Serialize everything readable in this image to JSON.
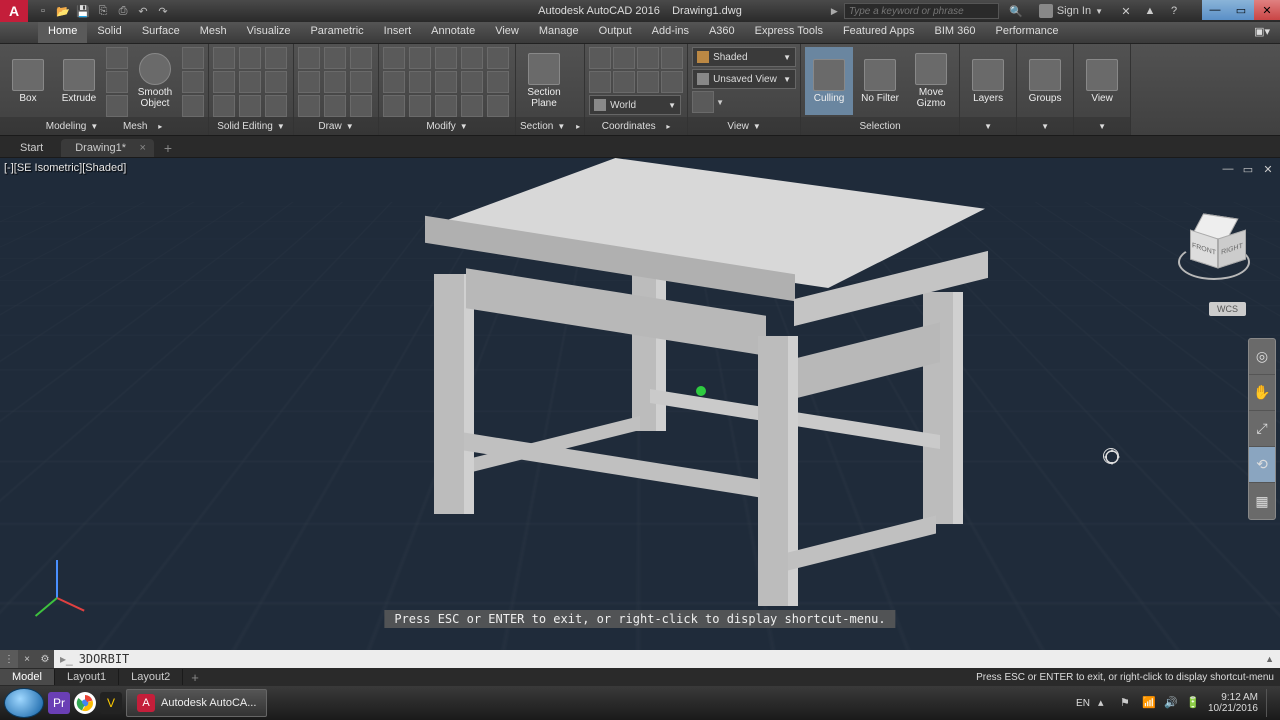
{
  "titlebar": {
    "app": "Autodesk AutoCAD 2016",
    "doc": "Drawing1.dwg",
    "search_placeholder": "Type a keyword or phrase",
    "signin": "Sign In"
  },
  "ribbon": {
    "tabs": [
      "Home",
      "Solid",
      "Surface",
      "Mesh",
      "Visualize",
      "Parametric",
      "Insert",
      "Annotate",
      "View",
      "Manage",
      "Output",
      "Add-ins",
      "A360",
      "Express Tools",
      "Featured Apps",
      "BIM 360",
      "Performance"
    ],
    "active_tab": "Home",
    "modeling": {
      "box": "Box",
      "extrude": "Extrude",
      "smooth": "Smooth Object",
      "label": "Modeling"
    },
    "mesh": {
      "label": "Mesh"
    },
    "solid_editing": {
      "label": "Solid Editing"
    },
    "draw": {
      "label": "Draw"
    },
    "modify": {
      "label": "Modify"
    },
    "section": {
      "plane": "Section Plane",
      "label": "Section"
    },
    "coordinates": {
      "world": "World",
      "label": "Coordinates"
    },
    "view": {
      "style": "Shaded",
      "saved": "Unsaved View",
      "label": "View"
    },
    "selection": {
      "culling": "Culling",
      "nofilter": "No Filter",
      "gizmo": "Move Gizmo",
      "label": "Selection"
    },
    "layers": {
      "label": "Layers"
    },
    "groups": {
      "label": "Groups"
    },
    "viewpanel": {
      "label": "View"
    }
  },
  "filetabs": {
    "start": "Start",
    "drawing": "Drawing1*"
  },
  "viewport": {
    "label": "[-][SE Isometric][Shaded]",
    "wcs": "WCS",
    "viewcube": {
      "front": "FRONT",
      "right": "RIGHT"
    },
    "hint": "Press ESC or ENTER to exit, or right-click to display shortcut-menu."
  },
  "command": {
    "active": "3DORBIT"
  },
  "layouts": {
    "model": "Model",
    "l1": "Layout1",
    "l2": "Layout2"
  },
  "status_text": "Press ESC or ENTER to exit, or right-click to display shortcut-menu",
  "taskbar": {
    "app": "Autodesk AutoCA...",
    "lang": "EN",
    "time": "9:12 AM",
    "date": "10/21/2016"
  }
}
